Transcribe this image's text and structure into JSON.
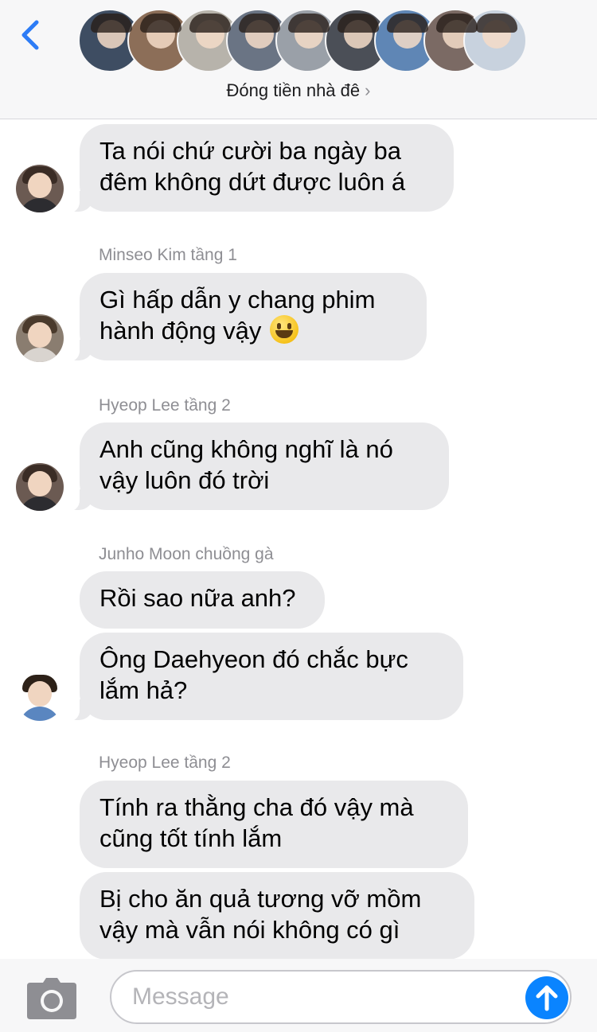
{
  "header": {
    "back_icon": "chevron-left-icon",
    "group_name": "Đóng tiền nhà đê",
    "group_chevron": "›",
    "accent_color": "#2d7cf6",
    "participant_count_avatars": 9
  },
  "messages": [
    {
      "sender": "",
      "lines": [
        "Ta nói chứ cười ba ngày ba",
        "đêm không dứt được luôn á"
      ]
    },
    {
      "sender": "Minseo Kim tầng 1",
      "lines": [
        "Gì hấp dẫn y chang phim",
        "hành động vậy"
      ],
      "emoji": "grinning-face-emoji"
    },
    {
      "sender": "Hyeop Lee tầng 2",
      "lines": [
        "Anh cũng không nghĩ là nó",
        "vậy luôn đó trời"
      ]
    },
    {
      "sender": "Junho Moon chuồng gà",
      "lines": [
        "Rồi sao nữa anh?"
      ]
    },
    {
      "sender": "",
      "lines": [
        "Ông Daehyeon đó chắc bực",
        "lắm hả?"
      ]
    },
    {
      "sender": "Hyeop Lee tầng 2",
      "lines": [
        "Tính ra thằng cha đó vậy mà",
        "cũng tốt tính lắm"
      ]
    },
    {
      "sender": "",
      "lines": [
        "Bị cho ăn quả tương vỡ mồm",
        "vậy mà vẫn nói không có gì"
      ]
    }
  ],
  "input_bar": {
    "placeholder": "Message",
    "value": "",
    "camera_icon": "camera-icon",
    "send_icon": "arrow-up-icon",
    "send_color": "#0a84ff"
  },
  "colors": {
    "bubble_bg": "#e9e9eb",
    "sender_text": "#8e8e93",
    "header_bg": "#f7f7f8"
  }
}
